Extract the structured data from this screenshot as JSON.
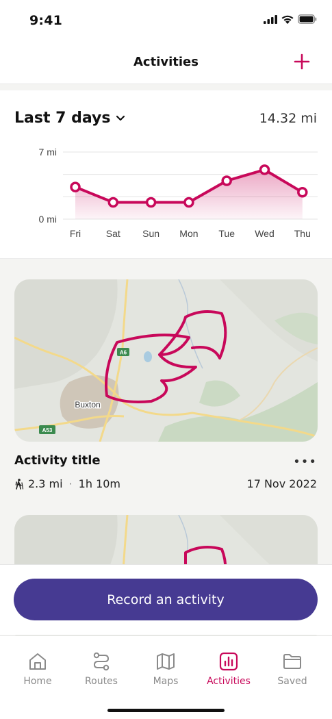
{
  "status_bar": {
    "time": "9:41"
  },
  "header": {
    "title": "Activities"
  },
  "summary": {
    "range_label": "Last 7 days",
    "total_distance": "14.32 mi"
  },
  "chart_data": {
    "type": "area",
    "categories": [
      "Fri",
      "Sat",
      "Sun",
      "Mon",
      "Tue",
      "Wed",
      "Thu"
    ],
    "values": [
      3.35,
      1.75,
      1.75,
      1.75,
      4.0,
      5.15,
      2.8
    ],
    "y_ticks": [
      "7 mi",
      "0 mi"
    ],
    "ylim": [
      0,
      7
    ],
    "grid": true,
    "color": "#c8085a"
  },
  "activities": [
    {
      "title": "Activity title",
      "distance": "2.3 mi",
      "duration": "1h 10m",
      "date": "17 Nov 2022",
      "map_labels": {
        "town": "Buxton",
        "road_a6": "A6",
        "road_a53": "A53"
      }
    }
  ],
  "actions": {
    "record_label": "Record an activity",
    "more_label": "•••"
  },
  "tabs": [
    {
      "label": "Home",
      "icon": "home-icon",
      "active": false
    },
    {
      "label": "Routes",
      "icon": "routes-icon",
      "active": false
    },
    {
      "label": "Maps",
      "icon": "maps-icon",
      "active": false
    },
    {
      "label": "Activities",
      "icon": "activities-icon",
      "active": true
    },
    {
      "label": "Saved",
      "icon": "folder-icon",
      "active": false
    }
  ],
  "colors": {
    "accent": "#c8085a",
    "primary_button": "#463a92"
  }
}
